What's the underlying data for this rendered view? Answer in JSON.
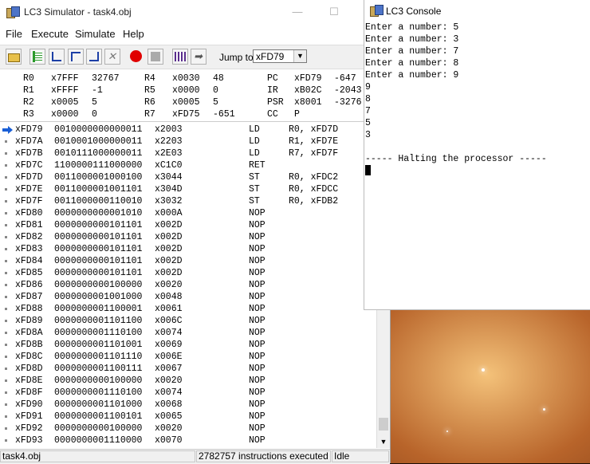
{
  "simulator": {
    "title": "LC3 Simulator - task4.obj",
    "window_buttons": {
      "minimize": "—",
      "maximize": "☐"
    },
    "menu": [
      "File",
      "Execute",
      "Simulate",
      "Help"
    ],
    "toolbar": {
      "jump_label": "Jump to:",
      "jump_value": "xFD79"
    },
    "registers": [
      {
        "name": "R0",
        "hex": "x7FFF",
        "dec": "32767"
      },
      {
        "name": "R1",
        "hex": "xFFFF",
        "dec": "-1"
      },
      {
        "name": "R2",
        "hex": "x0005",
        "dec": "5"
      },
      {
        "name": "R3",
        "hex": "x0000",
        "dec": "0"
      },
      {
        "name": "R4",
        "hex": "x0030",
        "dec": "48"
      },
      {
        "name": "R5",
        "hex": "x0000",
        "dec": "0"
      },
      {
        "name": "R6",
        "hex": "x0005",
        "dec": "5"
      },
      {
        "name": "R7",
        "hex": "xFD75",
        "dec": "-651"
      },
      {
        "name": "PC",
        "hex": "xFD79",
        "dec": "-647"
      },
      {
        "name": "IR",
        "hex": "xB02C",
        "dec": "-2043"
      },
      {
        "name": "PSR",
        "hex": "x8001",
        "dec": "-3276"
      },
      {
        "name": "CC",
        "hex": "P",
        "dec": ""
      }
    ],
    "memory": [
      {
        "addr": "xFD79",
        "bin": "0010000000000011",
        "hex": "x2003",
        "op": "LD",
        "args": "R0, xFD7D"
      },
      {
        "addr": "xFD7A",
        "bin": "0010001000000011",
        "hex": "x2203",
        "op": "LD",
        "args": "R1, xFD7E"
      },
      {
        "addr": "xFD7B",
        "bin": "0010111000000011",
        "hex": "x2E03",
        "op": "LD",
        "args": "R7, xFD7F"
      },
      {
        "addr": "xFD7C",
        "bin": "1100000111000000",
        "hex": "xC1C0",
        "op": "RET",
        "args": ""
      },
      {
        "addr": "xFD7D",
        "bin": "0011000001000100",
        "hex": "x3044",
        "op": "ST",
        "args": "R0, xFDC2"
      },
      {
        "addr": "xFD7E",
        "bin": "0011000001001101",
        "hex": "x304D",
        "op": "ST",
        "args": "R0, xFDCC"
      },
      {
        "addr": "xFD7F",
        "bin": "0011000000110010",
        "hex": "x3032",
        "op": "ST",
        "args": "R0, xFDB2"
      },
      {
        "addr": "xFD80",
        "bin": "0000000000001010",
        "hex": "x000A",
        "op": "NOP",
        "args": ""
      },
      {
        "addr": "xFD81",
        "bin": "0000000000101101",
        "hex": "x002D",
        "op": "NOP",
        "args": ""
      },
      {
        "addr": "xFD82",
        "bin": "0000000000101101",
        "hex": "x002D",
        "op": "NOP",
        "args": ""
      },
      {
        "addr": "xFD83",
        "bin": "0000000000101101",
        "hex": "x002D",
        "op": "NOP",
        "args": ""
      },
      {
        "addr": "xFD84",
        "bin": "0000000000101101",
        "hex": "x002D",
        "op": "NOP",
        "args": ""
      },
      {
        "addr": "xFD85",
        "bin": "0000000000101101",
        "hex": "x002D",
        "op": "NOP",
        "args": ""
      },
      {
        "addr": "xFD86",
        "bin": "0000000000100000",
        "hex": "x0020",
        "op": "NOP",
        "args": ""
      },
      {
        "addr": "xFD87",
        "bin": "0000000001001000",
        "hex": "x0048",
        "op": "NOP",
        "args": ""
      },
      {
        "addr": "xFD88",
        "bin": "0000000001100001",
        "hex": "x0061",
        "op": "NOP",
        "args": ""
      },
      {
        "addr": "xFD89",
        "bin": "0000000001101100",
        "hex": "x006C",
        "op": "NOP",
        "args": ""
      },
      {
        "addr": "xFD8A",
        "bin": "0000000001110100",
        "hex": "x0074",
        "op": "NOP",
        "args": ""
      },
      {
        "addr": "xFD8B",
        "bin": "0000000001101001",
        "hex": "x0069",
        "op": "NOP",
        "args": ""
      },
      {
        "addr": "xFD8C",
        "bin": "0000000001101110",
        "hex": "x006E",
        "op": "NOP",
        "args": ""
      },
      {
        "addr": "xFD8D",
        "bin": "0000000001100111",
        "hex": "x0067",
        "op": "NOP",
        "args": ""
      },
      {
        "addr": "xFD8E",
        "bin": "0000000000100000",
        "hex": "x0020",
        "op": "NOP",
        "args": ""
      },
      {
        "addr": "xFD8F",
        "bin": "0000000001110100",
        "hex": "x0074",
        "op": "NOP",
        "args": ""
      },
      {
        "addr": "xFD90",
        "bin": "0000000001101000",
        "hex": "x0068",
        "op": "NOP",
        "args": ""
      },
      {
        "addr": "xFD91",
        "bin": "0000000001100101",
        "hex": "x0065",
        "op": "NOP",
        "args": ""
      },
      {
        "addr": "xFD92",
        "bin": "0000000000100000",
        "hex": "x0020",
        "op": "NOP",
        "args": ""
      },
      {
        "addr": "xFD93",
        "bin": "0000000001110000",
        "hex": "x0070",
        "op": "NOP",
        "args": ""
      }
    ],
    "status": {
      "file": "task4.obj",
      "instructions": "2782757 instructions executed",
      "state": "Idle"
    }
  },
  "console": {
    "title": "LC3 Console",
    "lines": [
      "Enter a number: 5",
      "Enter a number: 3",
      "Enter a number: 7",
      "Enter a number: 8",
      "Enter a number: 9",
      "9",
      "8",
      "7",
      "5",
      "3",
      "",
      "----- Halting the processor -----"
    ]
  },
  "colors": {
    "pc_arrow": "#1a5fd6",
    "breakpoint": "#e00000"
  }
}
